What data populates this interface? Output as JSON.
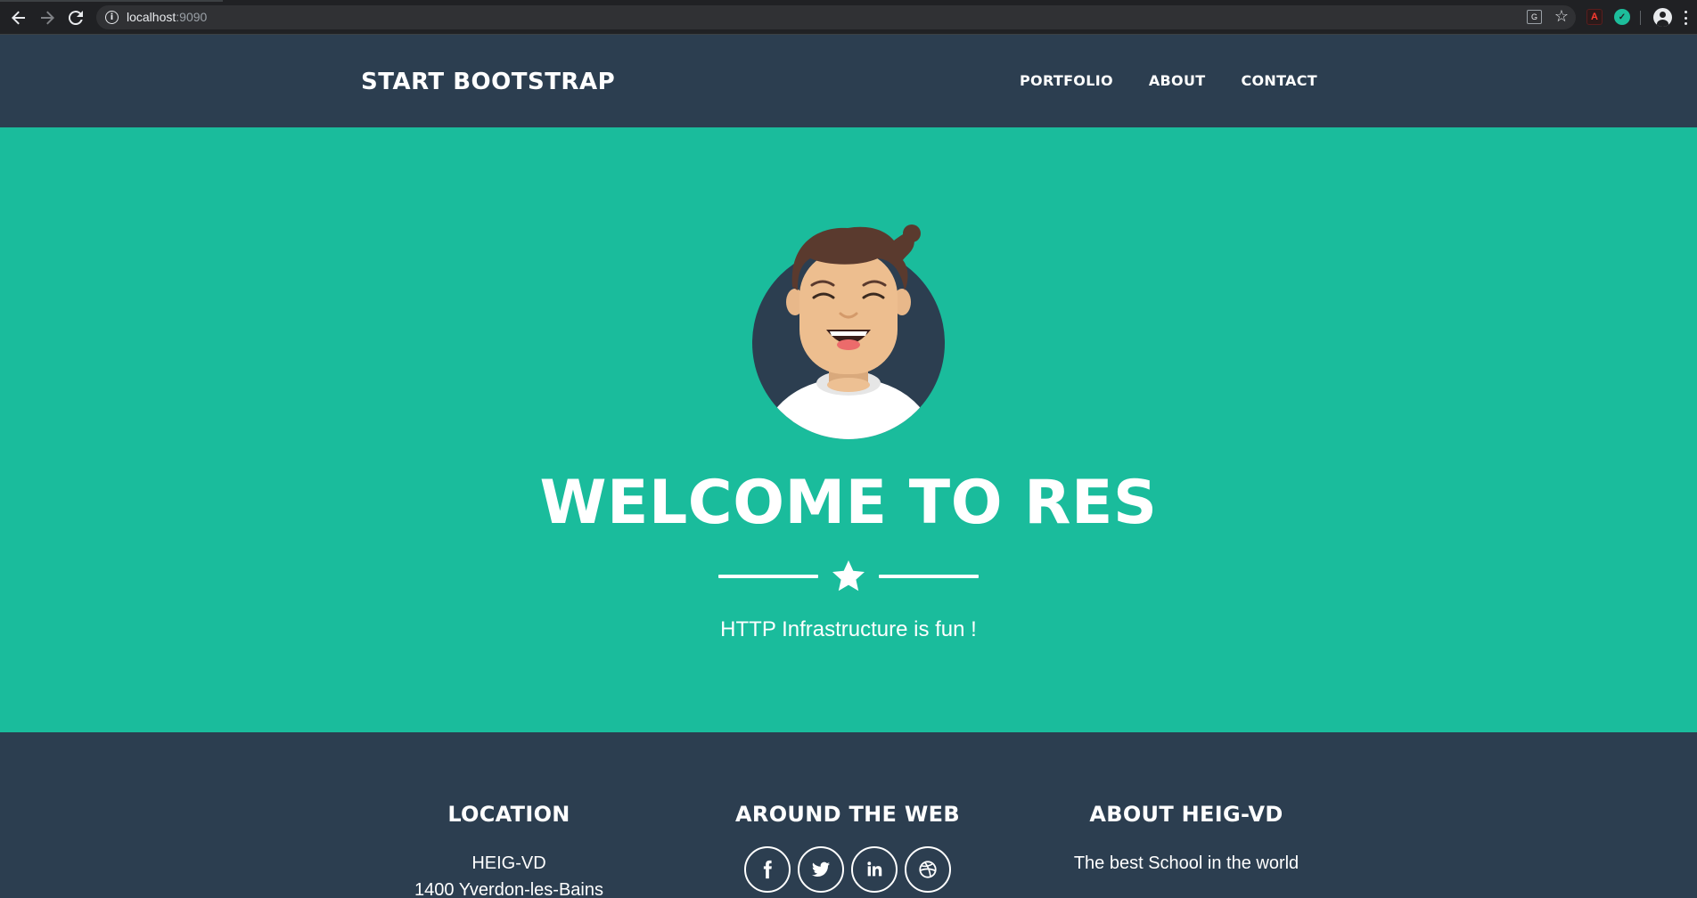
{
  "browser": {
    "url_host": "localhost",
    "url_port": ":9090",
    "back_icon": "arrow-left-icon",
    "forward_icon": "arrow-right-icon",
    "reload_icon": "reload-icon"
  },
  "navbar": {
    "brand": "START BOOTSTRAP",
    "links": [
      "PORTFOLIO",
      "ABOUT",
      "CONTACT"
    ]
  },
  "masthead": {
    "title": "WELCOME TO RES",
    "subtitle": "HTTP Infrastructure is fun !",
    "divider_icon": "star-icon"
  },
  "footer": {
    "location": {
      "title": "LOCATION",
      "line1": "HEIG-VD",
      "line2": "1400 Yverdon-les-Bains"
    },
    "web": {
      "title": "AROUND THE WEB",
      "socials": [
        "facebook-icon",
        "twitter-icon",
        "linkedin-icon",
        "dribbble-icon"
      ]
    },
    "about": {
      "title": "ABOUT HEIG-VD",
      "text": "The best School in the world"
    }
  },
  "colors": {
    "primary": "#1abc9c",
    "dark": "#2c3e50",
    "text": "#ffffff"
  }
}
